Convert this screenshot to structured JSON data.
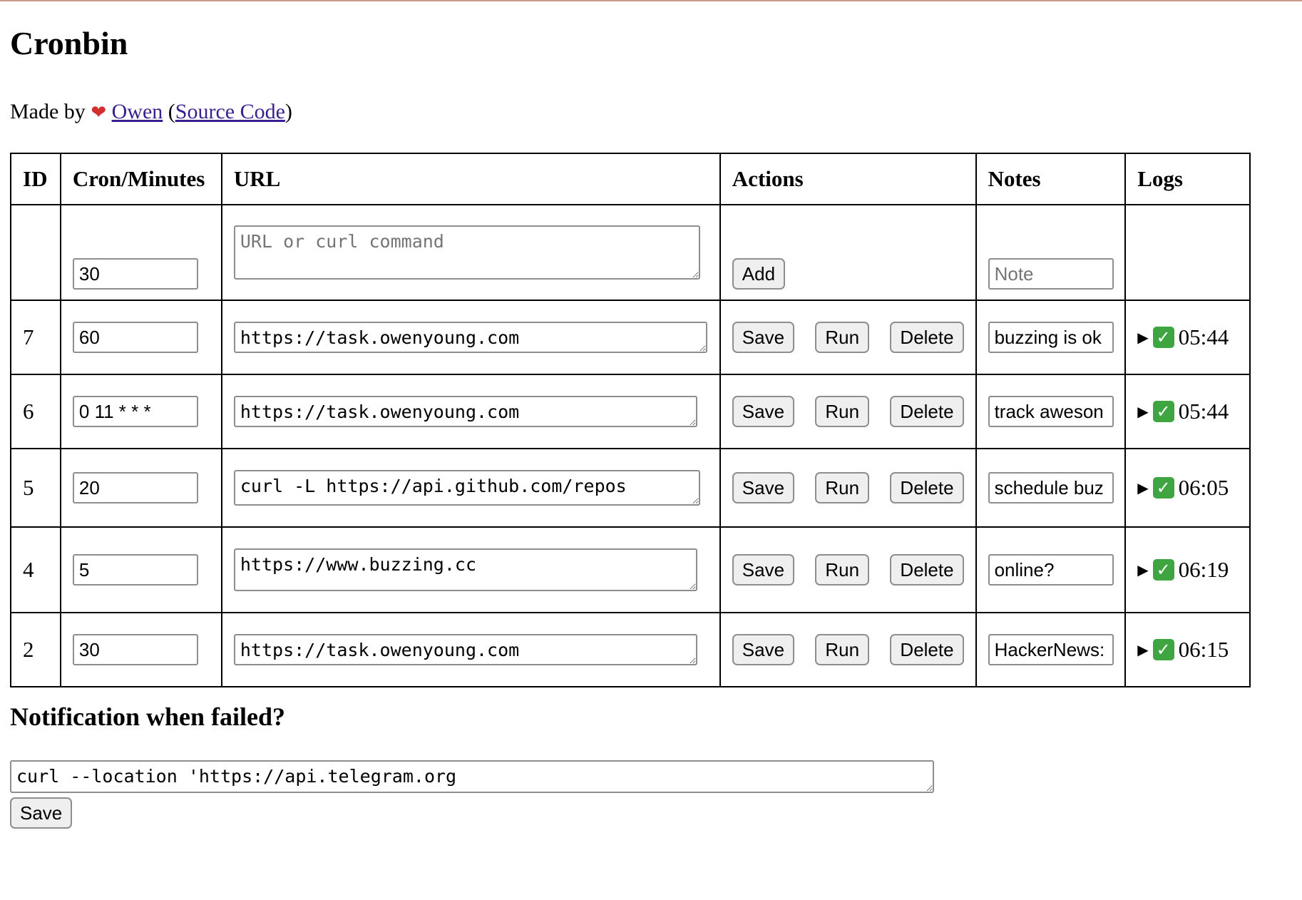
{
  "title": "Cronbin",
  "made_by": {
    "prefix": "Made by",
    "heart": "❤",
    "author_link": "Owen",
    "paren_open": "(",
    "source_link": "Source Code",
    "paren_close": ")"
  },
  "table": {
    "headers": [
      "ID",
      "Cron/Minutes",
      "URL",
      "Actions",
      "Notes",
      "Logs"
    ],
    "new_row": {
      "cron_value": "30",
      "url_placeholder": "URL or curl command",
      "add_label": "Add",
      "note_placeholder": "Note"
    },
    "rows": [
      {
        "id": "7",
        "cron": "60",
        "url": "https://task.owenyoung.com",
        "note": "buzzing is ok",
        "log_time": "05:44"
      },
      {
        "id": "6",
        "cron": "0 11 * * *",
        "url": "https://task.owenyoung.com",
        "note": "track aweson",
        "log_time": "05:44"
      },
      {
        "id": "5",
        "cron": "20",
        "url": "curl -L https://api.github.com/repos",
        "note": "schedule buz",
        "log_time": "06:05"
      },
      {
        "id": "4",
        "cron": "5",
        "url": "https://www.buzzing.cc",
        "note": "online?",
        "log_time": "06:19"
      },
      {
        "id": "2",
        "cron": "30",
        "url": "https://task.owenyoung.com",
        "note": "HackerNews:",
        "log_time": "06:15"
      }
    ],
    "action_labels": {
      "save": "Save",
      "run": "Run",
      "delete": "Delete"
    },
    "log_toggle": "▶",
    "log_status": "✓",
    "status_color": "#3fa540"
  },
  "notification": {
    "heading": "Notification when failed?",
    "value": "curl --location 'https://api.telegram.org",
    "save_label": "Save"
  }
}
